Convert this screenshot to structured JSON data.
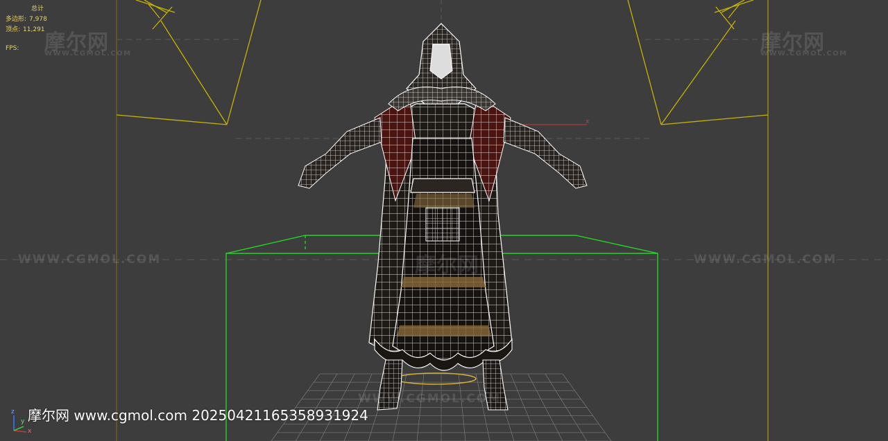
{
  "app": {
    "name": "3D viewport"
  },
  "statistics": {
    "header": "总计",
    "polygons_label": "多边形:",
    "polygons_value": "7,978",
    "vertices_label": "顶点:",
    "vertices_value": "11,291",
    "fps_label": "FPS:"
  },
  "watermarks": {
    "logo_text": "摩尔网",
    "url_small": "WWW.CGMOL.COM",
    "url_wide": "WWW.CGMOL.COM"
  },
  "footer_watermark": "摩尔网 www.cgmol.com 20250421165358931924",
  "axis": {
    "z": "z",
    "y": "y",
    "x": "x"
  },
  "colors": {
    "viewport_bg": "#3d3d3d",
    "stats_text": "#e8d36a",
    "camera_lines": "#c8b400",
    "bounding_box": "#22d722",
    "wireframe": "#ffffff",
    "x_axis": "#c83c3c",
    "robe_dark": "#1e1a16",
    "robe_red": "#4a1410",
    "trim_gold": "#8a6a3a"
  },
  "icons": {
    "axis_gizmo": "axis-tripod-icon"
  }
}
